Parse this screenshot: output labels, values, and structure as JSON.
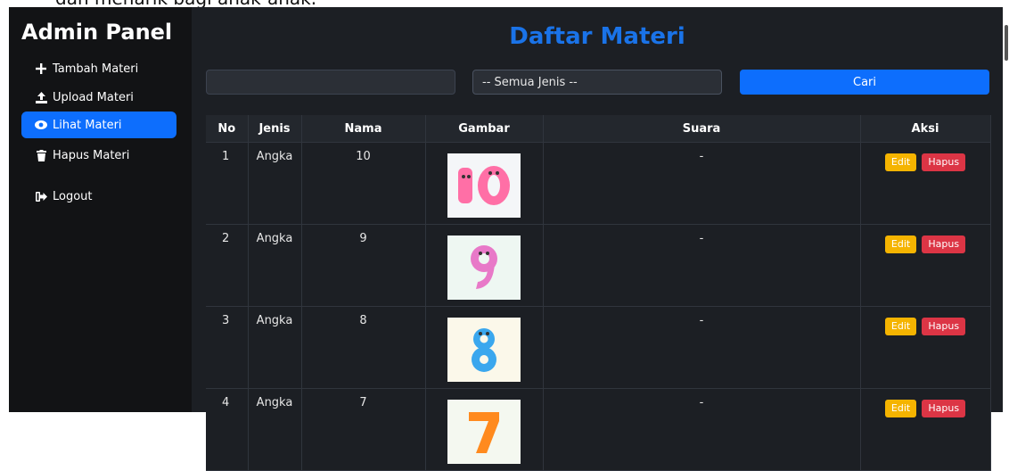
{
  "top_text": "dan menarik bagi anak-anak.",
  "sidebar": {
    "brand": "Admin Panel",
    "items": [
      {
        "label": "Tambah Materi",
        "icon": "plus-icon"
      },
      {
        "label": "Upload Materi",
        "icon": "upload-icon"
      },
      {
        "label": "Lihat Materi",
        "icon": "eye-icon",
        "active": true
      },
      {
        "label": "Hapus Materi",
        "icon": "trash-icon"
      },
      {
        "label": "Logout",
        "icon": "logout-icon"
      }
    ]
  },
  "main": {
    "title": "Daftar Materi",
    "search": {
      "placeholder": "",
      "value": ""
    },
    "type_select": {
      "selected": "-- Semua Jenis --"
    },
    "search_button": "Cari"
  },
  "table": {
    "headers": [
      "No",
      "Jenis",
      "Nama",
      "Gambar",
      "Suara",
      "Aksi"
    ],
    "rows": [
      {
        "no": "1",
        "jenis": "Angka",
        "nama": "10",
        "suara": "-",
        "image_color": "#ff6fa6"
      },
      {
        "no": "2",
        "jenis": "Angka",
        "nama": "9",
        "suara": "-",
        "image_color": "#e879c8"
      },
      {
        "no": "3",
        "jenis": "Angka",
        "nama": "8",
        "suara": "-",
        "image_color": "#3aa7ee"
      },
      {
        "no": "4",
        "jenis": "Angka",
        "nama": "7",
        "suara": "-",
        "image_color": "#ff8a1e"
      }
    ],
    "edit_label": "Edit",
    "delete_label": "Hapus"
  },
  "colors": {
    "accent": "#0d6efd",
    "title": "#1a73e8",
    "edit": "#f5b400",
    "delete": "#dc3545"
  }
}
